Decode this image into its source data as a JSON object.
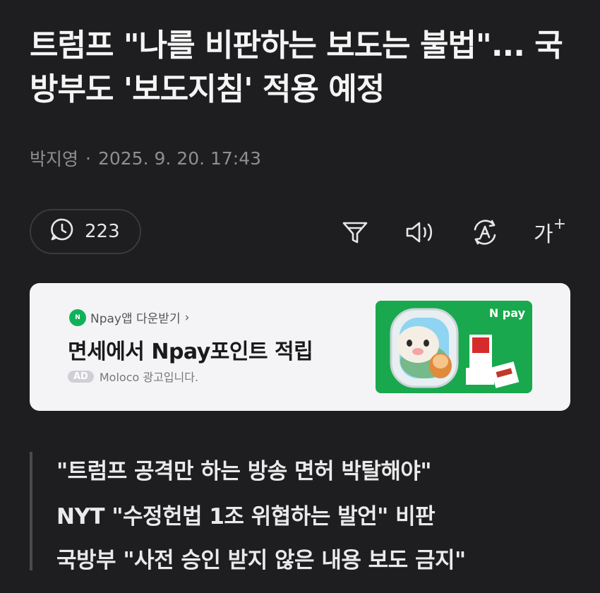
{
  "article": {
    "headline": "트럼프 \"나를 비판하는 보도는 불법\"... 국방부도 '보도지침' 적용 예정",
    "author": "박지영",
    "date": "2025. 9. 20. 17:43"
  },
  "toolbar": {
    "comment_count": "223",
    "icons": [
      "comment-clock-icon",
      "filter-icon",
      "speaker-icon",
      "translate-icon",
      "font-size-icon"
    ],
    "font_size_label": "가"
  },
  "ad": {
    "source": "Npay앱 다운받기",
    "source_chevron": "›",
    "title": "면세에서 Npay포인트 적립",
    "badge": "AD",
    "advertiser": "Moloco 광고입니다.",
    "image_brand": "N pay",
    "brand_color": "#19a84d"
  },
  "quote": {
    "lines": [
      "\"트럼프 공격만 하는 방송 면허 박탈해야\"",
      "NYT \"수정헌법 1조 위협하는 발언\" 비판",
      "국방부 \"사전 승인 받지 않은 내용 보도 금지\""
    ]
  }
}
